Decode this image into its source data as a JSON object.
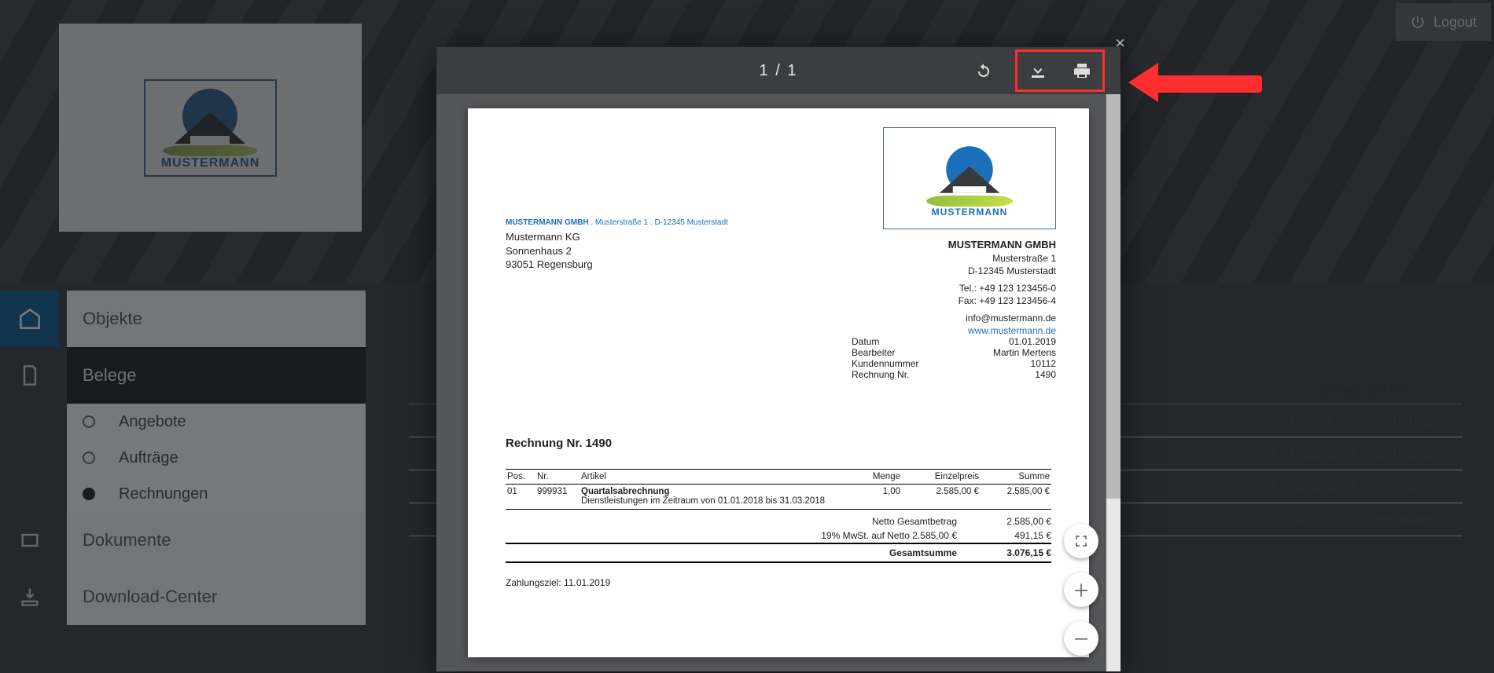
{
  "app": {
    "logo_text": "MUSTERMANN",
    "logout_label": "Logout"
  },
  "nav": {
    "items": [
      {
        "label": "Objekte"
      },
      {
        "label": "Belege"
      },
      {
        "label": "Dokumente"
      },
      {
        "label": "Download-Center"
      }
    ],
    "belege_sub": [
      {
        "label": "Angebote",
        "selected": false
      },
      {
        "label": "Aufträge",
        "selected": false
      },
      {
        "label": "Rechnungen",
        "selected": true
      }
    ]
  },
  "bg_table": {
    "headers": {
      "betrag": "Betrag",
      "zahlart": "Zahlart"
    },
    "rows": [
      {
        "betrag": "3.076,15 EUR",
        "zahlart": "Rechnung"
      },
      {
        "betrag": "3.076,15 EUR",
        "zahlart": "Rechnung"
      },
      {
        "betrag": "3.076,15 EUR",
        "zahlart": "Rechnung"
      },
      {
        "betrag": "3.076,15 EUR",
        "zahlart": "Rechnung"
      }
    ]
  },
  "viewer": {
    "page_indicator": "1 / 1",
    "close": "×"
  },
  "doc": {
    "logo_text": "MUSTERMANN",
    "sender_line_company": "MUSTERMANN GMBH",
    "sender_line_rest": " . Musterstraße 1 . D-12345 Musterstadt",
    "recipient": {
      "name": "Mustermann KG",
      "street": "Sonnenhaus 2",
      "city": "93051 Regensburg"
    },
    "company": {
      "name": "MUSTERMANN GMBH",
      "street": "Musterstraße 1",
      "city": "D-12345 Musterstadt",
      "tel": "Tel.: +49 123 123456-0",
      "fax": "Fax: +49 123 123456-4",
      "email": "info@mustermann.de",
      "web": "www.mustermann.de"
    },
    "meta": {
      "date_label": "Datum",
      "date_value": "01.01.2019",
      "editor_label": "Bearbeiter",
      "editor_value": "Martin Mertens",
      "custno_label": "Kundennummer",
      "custno_value": "10112",
      "invno_label": "Rechnung Nr.",
      "invno_value": "1490"
    },
    "title": "Rechnung Nr. 1490",
    "table": {
      "headers": {
        "pos": "Pos.",
        "nr": "Nr.",
        "artikel": "Artikel",
        "menge": "Menge",
        "einzelpreis": "Einzelpreis",
        "summe": "Summe"
      },
      "rows": [
        {
          "pos": "01",
          "nr": "999931",
          "artikel_title": "Quartalsabrechnung",
          "artikel_desc": "Dienstleistungen im Zeitraum von 01.01.2018 bis 31.03.2018",
          "menge": "1,00",
          "einzelpreis": "2.585,00 €",
          "summe": "2.585,00 €"
        }
      ]
    },
    "totals": {
      "netto_label": "Netto Gesamtbetrag",
      "netto_value": "2.585,00 €",
      "mwst_label": "19% MwSt. auf Netto 2.585,00 €",
      "mwst_value": "491,15 €",
      "gesamt_label": "Gesamtsumme",
      "gesamt_value": "3.076,15 €"
    },
    "pay_term": "Zahlungsziel: 11.01.2019"
  }
}
